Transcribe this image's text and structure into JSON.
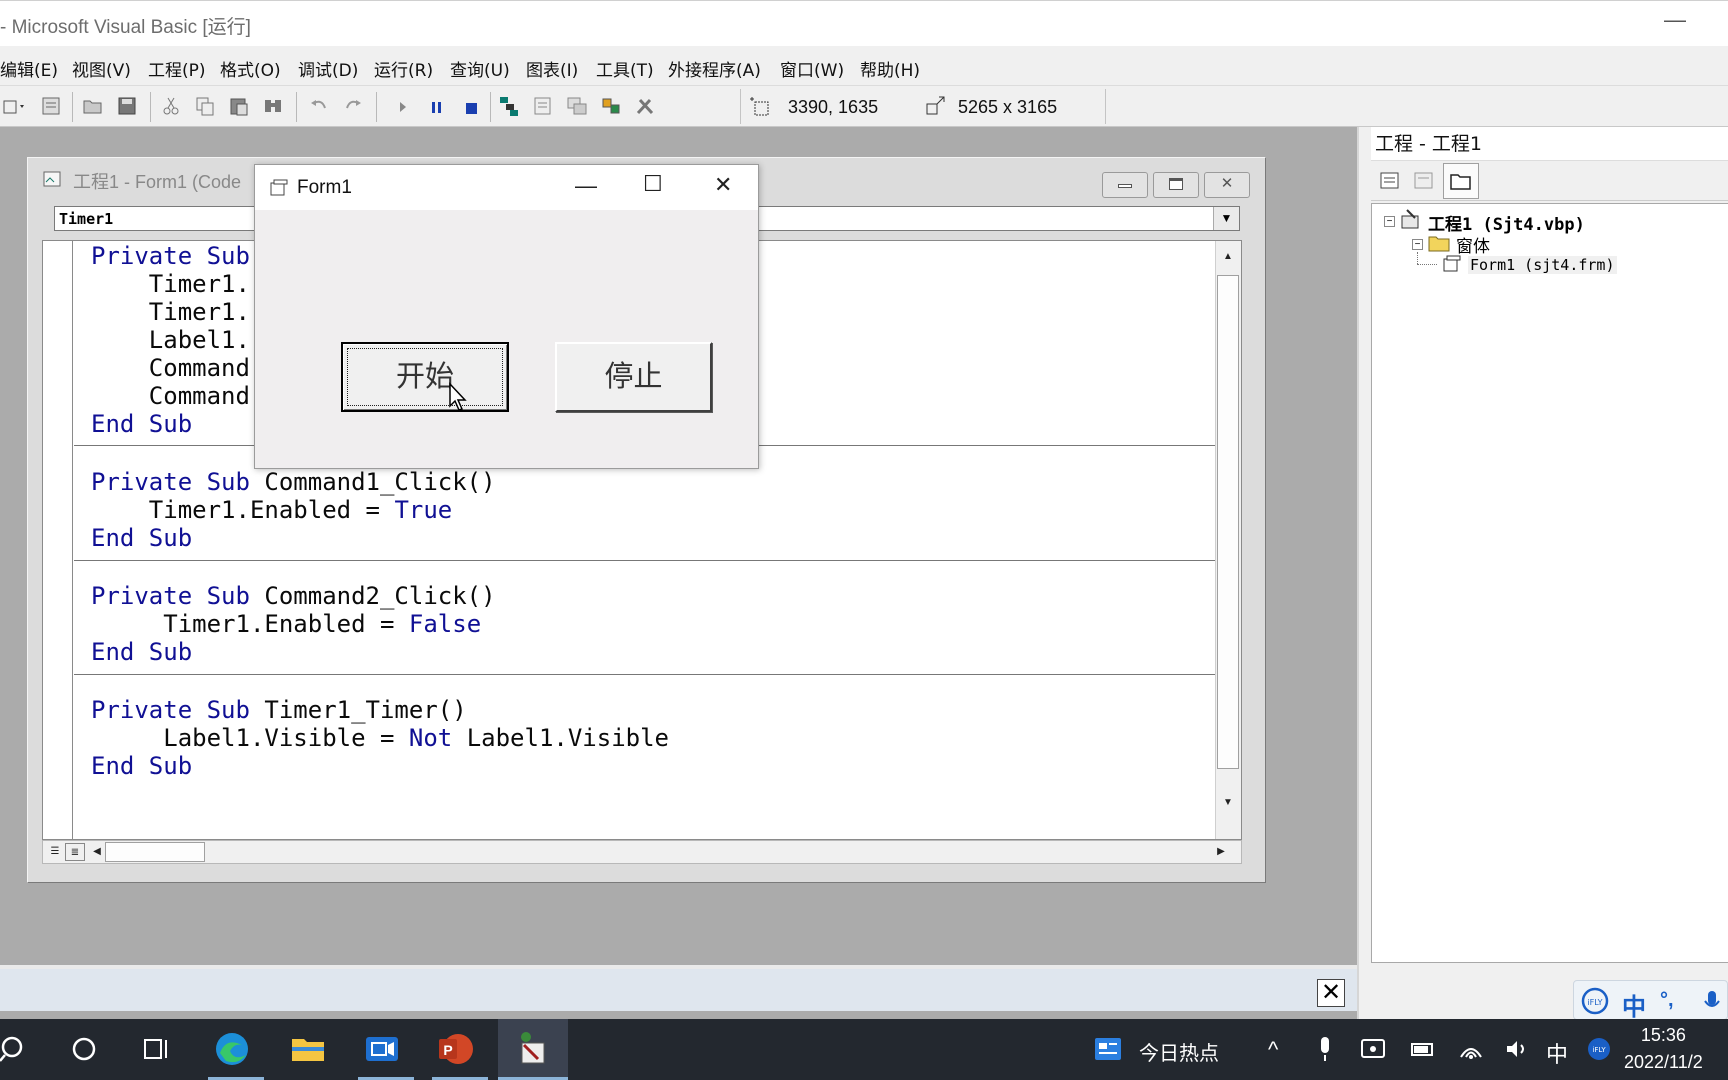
{
  "window": {
    "title": "- Microsoft Visual Basic [运行]"
  },
  "menu": [
    "编辑(E)",
    "视图(V)",
    "工程(P)",
    "格式(O)",
    "调试(D)",
    "运行(R)",
    "查询(U)",
    "图表(I)",
    "工具(T)",
    "外接程序(A)",
    "窗口(W)",
    "帮助(H)"
  ],
  "toolbar": {
    "position": "3390, 1635",
    "size": "5265 x 3165"
  },
  "code_window": {
    "title": "工程1 - Form1 (Code",
    "object_combo": "Timer1",
    "procedures": [
      {
        "lines": [
          "Private Sub",
          "    Timer1.",
          "    Timer1.",
          "    Label1.",
          "    Command",
          "    Command",
          "End Sub"
        ]
      },
      {
        "lines": [
          "Private Sub Command1_Click()",
          "    Timer1.Enabled = True",
          "End Sub"
        ]
      },
      {
        "lines": [
          "Private Sub Command2_Click()",
          "     Timer1.Enabled = False",
          "End Sub"
        ]
      },
      {
        "lines": [
          "Private Sub Timer1_Timer()",
          "     Label1.Visible = Not Label1.Visible",
          "End Sub"
        ]
      }
    ]
  },
  "form1": {
    "title": "Form1",
    "start_button": "开始",
    "stop_button": "停止"
  },
  "project": {
    "header": "工程 - 工程1",
    "root": "工程1 (Sjt4.vbp)",
    "folder": "窗体",
    "form": "Form1 (sjt4.frm)"
  },
  "taskbar": {
    "news": "今日热点",
    "time": "15:36",
    "date": "2022/11/2",
    "ime": "中"
  },
  "colors": {
    "keyword": "#101094",
    "taskbar": "#23282f"
  }
}
